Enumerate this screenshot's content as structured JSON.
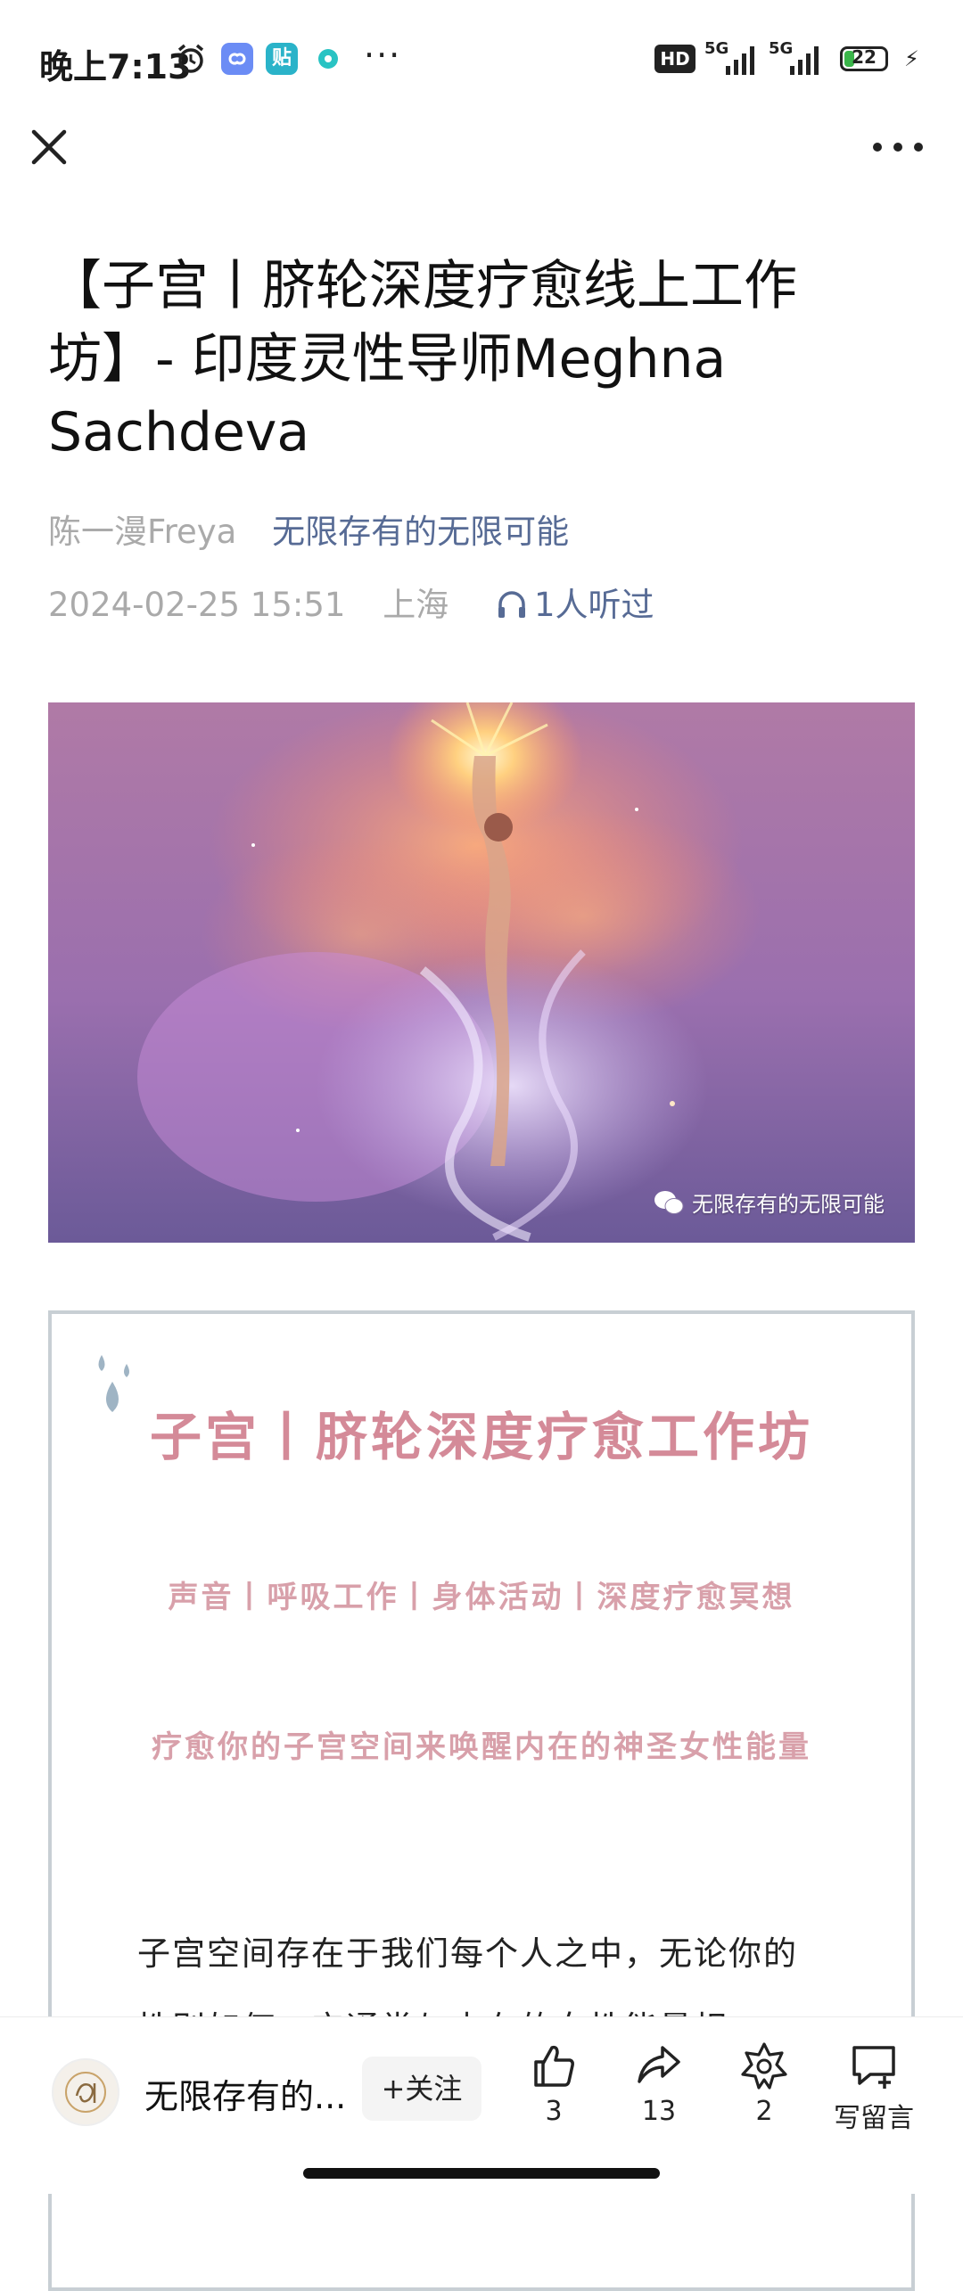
{
  "status_bar": {
    "time": "晚上7:13",
    "app_badge_text": "贴",
    "overflow": "···",
    "hd_label": "HD",
    "network_1": "5G",
    "network_2": "5G",
    "battery": "22"
  },
  "nav": {
    "close_icon": "close-icon",
    "more_icon": "more-icon"
  },
  "article": {
    "title": "【子宫丨脐轮深度疗愈线上工作坊】- 印度灵性导师Meghna Sachdeva",
    "author": "陈一漫Freya",
    "account": "无限存有的无限可能",
    "date": "2024-02-25 15:51",
    "location": "上海",
    "listens": "1人听过"
  },
  "hero": {
    "watermark": "无限存有的无限可能"
  },
  "card": {
    "title": "子宫丨脐轮深度疗愈工作坊",
    "sub1": "声音丨呼吸工作丨身体活动丨深度疗愈冥想",
    "sub2": "疗愈你的子宫空间来唤醒内在的神圣女性能量",
    "body": "子宫空间存在于我们每个人之中，无论你的性别如何，它通常与内在的女性能量相"
  },
  "bottom_bar": {
    "account_name": "无限存有的...",
    "follow_label": "+关注",
    "like_count": "3",
    "share_count": "13",
    "wow_count": "2",
    "comment_label": "写留言"
  }
}
